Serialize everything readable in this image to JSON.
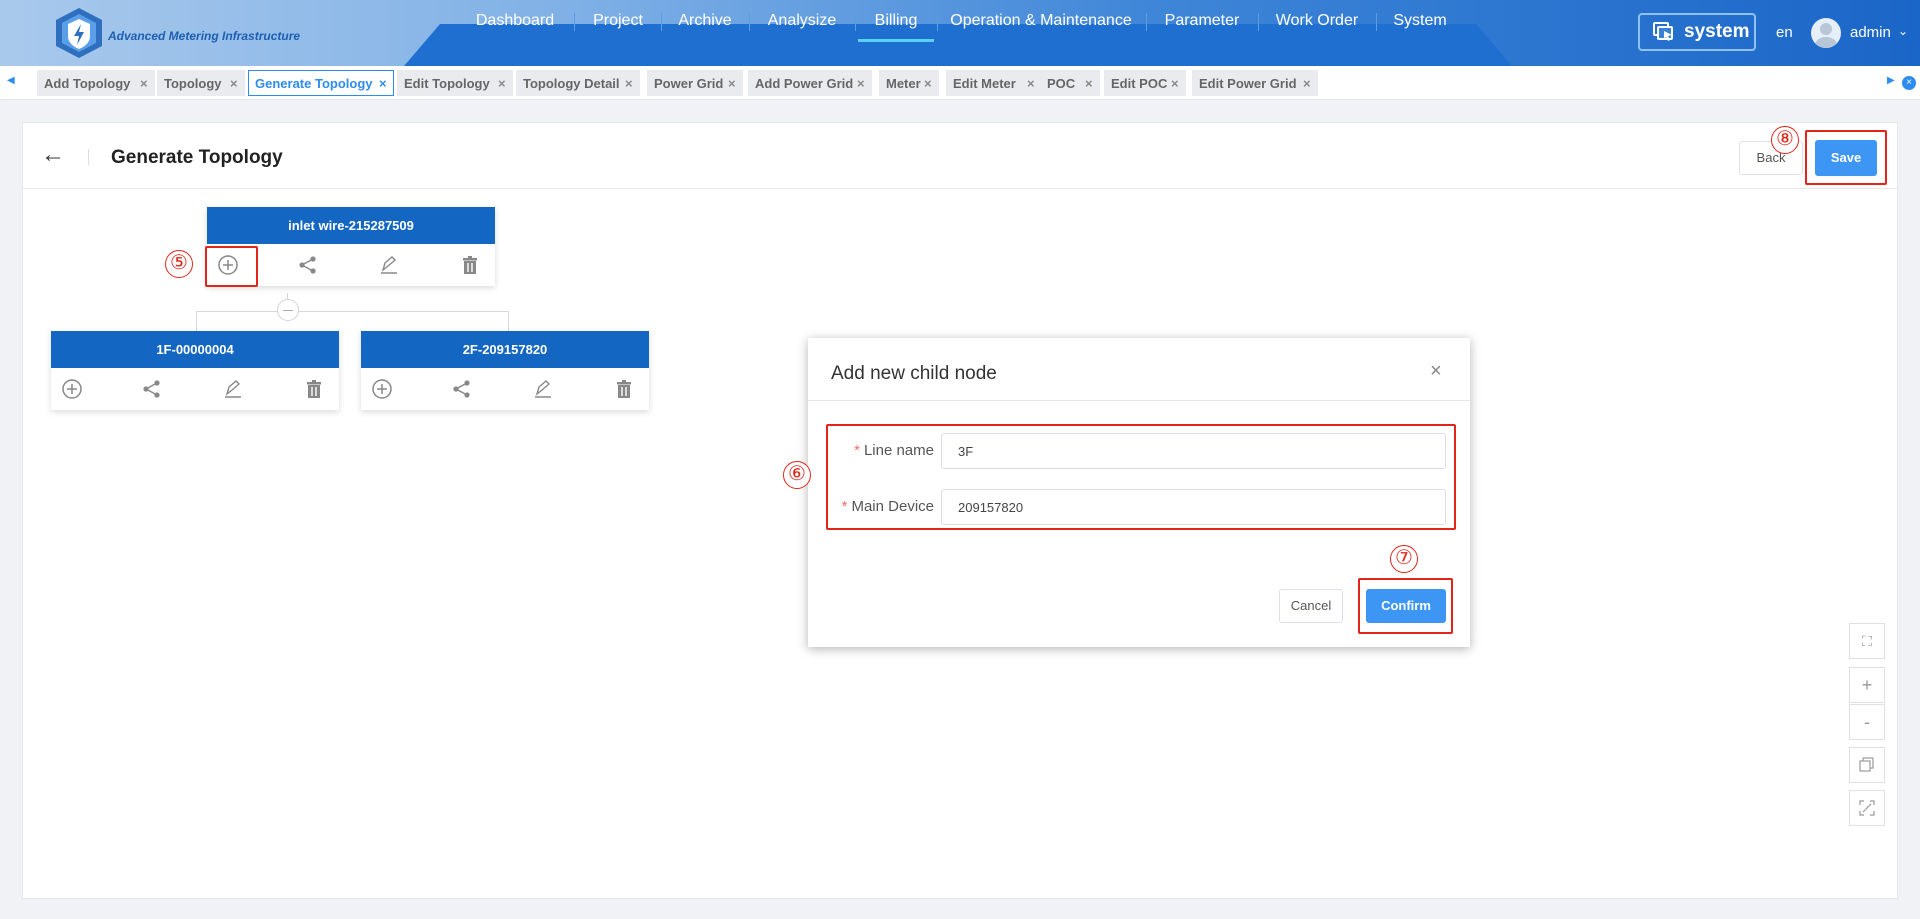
{
  "header": {
    "logo_text": "Advanced Metering Infrastructure",
    "nav": [
      "Dashboard",
      "Project",
      "Archive",
      "Analysize",
      "Billing",
      "Operation & Maintenance",
      "Parameter",
      "Work Order",
      "System"
    ],
    "active_nav": "Billing",
    "system_label": "system",
    "language": "en",
    "user": "admin"
  },
  "tabs": [
    "Add Topology",
    "Topology",
    "Generate Topology",
    "Edit Topology",
    "Topology Detail",
    "Power Grid",
    "Add Power Grid",
    "Meter",
    "Edit Meter",
    "POC",
    "Edit POC",
    "Edit Power Grid"
  ],
  "active_tab": "Generate Topology",
  "page": {
    "title": "Generate Topology",
    "back_label": "Back",
    "save_label": "Save"
  },
  "topology": {
    "root": "inlet wire-215287509",
    "children": [
      "1F-00000004",
      "2F-209157820"
    ]
  },
  "dialog": {
    "title": "Add new child node",
    "line_name_label": "Line name",
    "line_name_value": "3F",
    "main_device_label": "Main Device",
    "main_device_value": "209157820",
    "cancel_label": "Cancel",
    "confirm_label": "Confirm"
  },
  "annotations": {
    "n5": "⑤",
    "n6": "⑥",
    "n7": "⑦",
    "n8": "⑧"
  },
  "toolbar": {
    "zoom_in": "+",
    "zoom_out": "-"
  }
}
